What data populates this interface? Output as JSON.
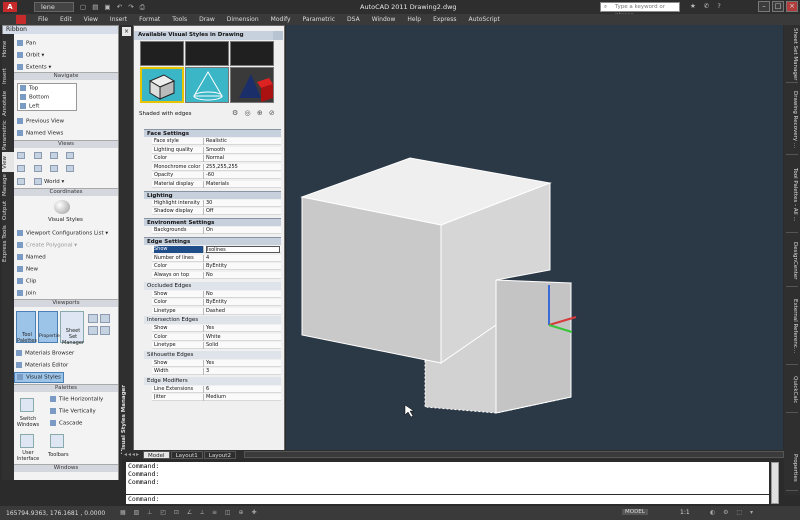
{
  "app": {
    "logo": "A",
    "workspace": "lene",
    "title": "AutoCAD 2011    Drawing2.dwg",
    "search_placeholder": "Type a keyword or phrase",
    "qat_icons": [
      "new-icon",
      "open-icon",
      "save-icon",
      "undo-icon",
      "redo-icon",
      "plot-icon"
    ]
  },
  "menubar": {
    "items": [
      "File",
      "Edit",
      "View",
      "Insert",
      "Format",
      "Tools",
      "Draw",
      "Dimension",
      "Modify",
      "Parametric",
      "DSA",
      "Window",
      "Help",
      "Express",
      "AutoScript"
    ]
  },
  "ribbon": {
    "header": "Ribbon",
    "vertical_tabs": [
      "Home",
      "Insert",
      "Annotate",
      "Parametric",
      "View",
      "Manage",
      "Output",
      "Express Tools"
    ],
    "active_tab": "View",
    "nav_items": [
      "Pan",
      "Orbit",
      "Extents"
    ],
    "sections": {
      "navigate": "Navigate",
      "views": "Views",
      "coordinates": "Coordinates",
      "viewports": "Viewports",
      "palettes": "Palettes",
      "windows": "Windows"
    },
    "views_list": [
      "Top",
      "Bottom",
      "Left"
    ],
    "view_buttons": [
      "Previous View",
      "Named Views"
    ],
    "coord_world": "World",
    "visual_styles": "Visual Styles",
    "viewport_items": [
      "Viewport Configurations List",
      "Create Polygonal",
      "Named",
      "New",
      "Clip",
      "Join"
    ],
    "palette_buttons": [
      "Tool Palettes",
      "Properties",
      "Sheet Set Manager"
    ],
    "palette_items": [
      "Materials Browser",
      "Materials Editor",
      "Visual Styles"
    ],
    "window_items": [
      "Tile Horizontally",
      "Tile Vertically",
      "Cascade"
    ],
    "window_buttons": [
      "Switch Windows",
      "User Interface",
      "Toolbars"
    ]
  },
  "visual_styles_manager": {
    "palette_label": "Visual Styles Manager",
    "available_title": "Available Visual Styles in Drawing",
    "current_style": "Shaded with edges",
    "sections": [
      {
        "title": "Face Settings",
        "rows": [
          {
            "k": "Face style",
            "v": "Realistic"
          },
          {
            "k": "Lighting quality",
            "v": "Smooth"
          },
          {
            "k": "Color",
            "v": "Normal"
          },
          {
            "k": "Monochrome color",
            "v": "255,255,255"
          },
          {
            "k": "Opacity",
            "v": "-60"
          },
          {
            "k": "Material display",
            "v": "Materials"
          }
        ]
      },
      {
        "title": "Lighting",
        "rows": [
          {
            "k": "Highlight intensity",
            "v": "30"
          },
          {
            "k": "Shadow display",
            "v": "Off"
          }
        ]
      },
      {
        "title": "Environment Settings",
        "rows": [
          {
            "k": "Backgrounds",
            "v": "On"
          }
        ]
      },
      {
        "title": "Edge Settings",
        "rows": [
          {
            "k": "Show",
            "v": "Isolines"
          },
          {
            "k": "Number of lines",
            "v": "4"
          },
          {
            "k": "Color",
            "v": "ByEntity"
          },
          {
            "k": "Always on top",
            "v": "No"
          }
        ]
      }
    ],
    "subsections": [
      {
        "title": "Occluded Edges",
        "rows": [
          {
            "k": "Show",
            "v": "No"
          },
          {
            "k": "Color",
            "v": "ByEntity"
          },
          {
            "k": "Linetype",
            "v": "Dashed"
          }
        ]
      },
      {
        "title": "Intersection Edges",
        "rows": [
          {
            "k": "Show",
            "v": "Yes"
          },
          {
            "k": "Color",
            "v": "White"
          },
          {
            "k": "Linetype",
            "v": "Solid"
          }
        ]
      },
      {
        "title": "Silhouette Edges",
        "rows": [
          {
            "k": "Show",
            "v": "Yes"
          },
          {
            "k": "Width",
            "v": "3"
          }
        ]
      },
      {
        "title": "Edge Modifiers",
        "rows": [
          {
            "k": "Line Extensions",
            "v": "6"
          },
          {
            "k": "Jitter",
            "v": "Medium"
          }
        ]
      }
    ]
  },
  "right_palettes": [
    "Sheet Set Manager",
    "Drawing Recovery ...",
    "Tool Palettes - All ...",
    "DesignCenter",
    "External Referenc...",
    "QuickCalc",
    "Properties"
  ],
  "layout_tabs": [
    "Model",
    "Layout1",
    "Layout2"
  ],
  "command": {
    "lines": [
      "Command:",
      "Command:",
      "Command:"
    ],
    "input": "Command:"
  },
  "status": {
    "coords": "165794.9363, 176.1681 , 0.0000",
    "model": "MODEL",
    "scale": "1:1"
  },
  "colors": {
    "viewport_bg": "#2b3846",
    "cube_top": "#efefef",
    "cube_front": "#c8c8c8",
    "cube_side": "#d6d6d6"
  }
}
